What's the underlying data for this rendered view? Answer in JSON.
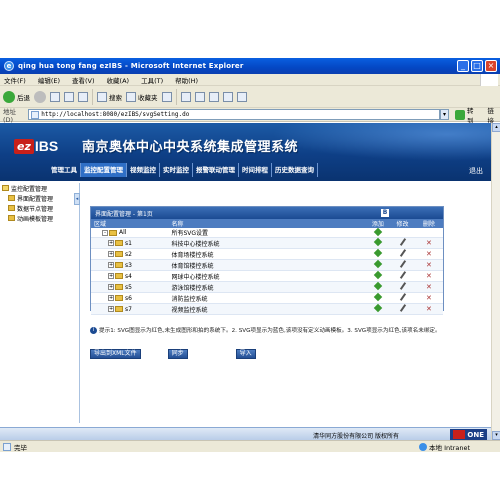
{
  "window": {
    "title": "qing hua tong fang ezIBS - Microsoft Internet Explorer"
  },
  "menu": [
    "文件(F)",
    "编辑(E)",
    "查看(V)",
    "收藏(A)",
    "工具(T)",
    "帮助(H)"
  ],
  "toolbar": {
    "back": "后退",
    "search": "搜索",
    "favorites": "收藏夹"
  },
  "address": {
    "label": "地址(D)",
    "url": "http://localhost:8080/ezIBS/svgSetting.do",
    "go": "转到",
    "links": "链接"
  },
  "app": {
    "logo_ez": "ez",
    "logo_ibs": "IBS",
    "title": "南京奥体中心中央系统集成管理系统",
    "nav": [
      "管理工具",
      "监控配置管理",
      "视频监控",
      "实时监控",
      "报警联动管理",
      "时间排程",
      "历史数据查询"
    ],
    "logout": "退出"
  },
  "tree": {
    "root": "监控配置管理",
    "children": [
      "界面配置管理",
      "数据节点管理",
      "动画模板管理"
    ]
  },
  "panel": {
    "title": "界面配置管理 - 第1页",
    "columns": {
      "area": "区域",
      "name": "名称",
      "add": "添加",
      "edit": "修改",
      "del": "删除"
    },
    "rows": [
      {
        "area": "All",
        "name": "所有SVG设置"
      },
      {
        "area": "s1",
        "name": "科技中心楼控系统"
      },
      {
        "area": "s2",
        "name": "体育场楼控系统"
      },
      {
        "area": "s3",
        "name": "体育馆楼控系统"
      },
      {
        "area": "s4",
        "name": "网球中心楼控系统"
      },
      {
        "area": "s5",
        "name": "游泳馆楼控系统"
      },
      {
        "area": "s6",
        "name": "消防监控系统"
      },
      {
        "area": "s7",
        "name": "视频监控系统"
      }
    ]
  },
  "tip": "提示1: SVG图显示为红色,未生成图形和拍的系统下。2. SVG项显示为蓝色,该项没有定义动画模板。3. SVG项显示为红色,该项名未绑定。",
  "buttons": {
    "export": "导出到XML文件",
    "sync": "同步",
    "import": "导入"
  },
  "footer": {
    "copyright": "清华同方股份有限公司 版权所有",
    "logo": "ONE"
  },
  "status": {
    "done": "完毕",
    "zone": "本地 Intranet"
  }
}
